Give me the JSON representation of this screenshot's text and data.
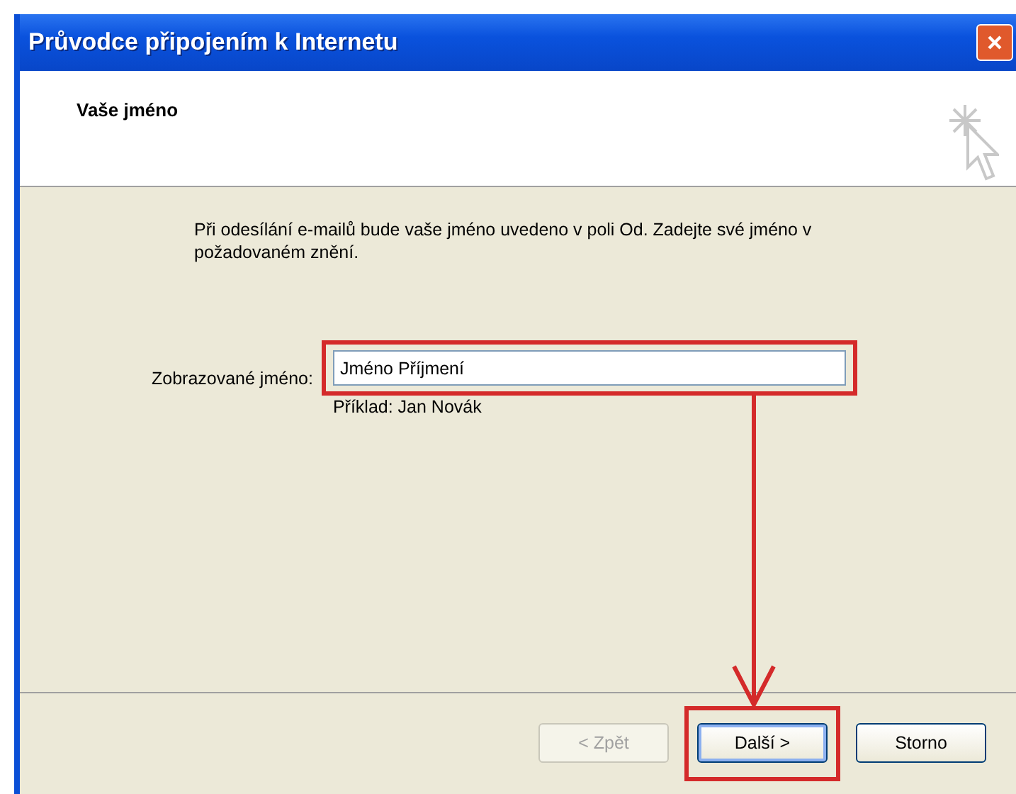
{
  "window": {
    "title": "Průvodce připojením k Internetu"
  },
  "header": {
    "title": "Vaše jméno"
  },
  "description": "Při odesílání e-mailů bude vaše jméno uvedeno v poli Od. Zadejte své jméno v požadovaném znění.",
  "field": {
    "label": "Zobrazované jméno:",
    "value": "Jméno Příjmení",
    "hint": "Příklad: Jan Novák",
    "highlighted": true
  },
  "buttons": [
    {
      "label": "< Zpět",
      "disabled": true,
      "default": false,
      "highlighted": false
    },
    {
      "label": "Další >",
      "disabled": false,
      "default": true,
      "highlighted": true
    },
    {
      "label": "Storno",
      "disabled": false,
      "default": false,
      "highlighted": false
    }
  ]
}
